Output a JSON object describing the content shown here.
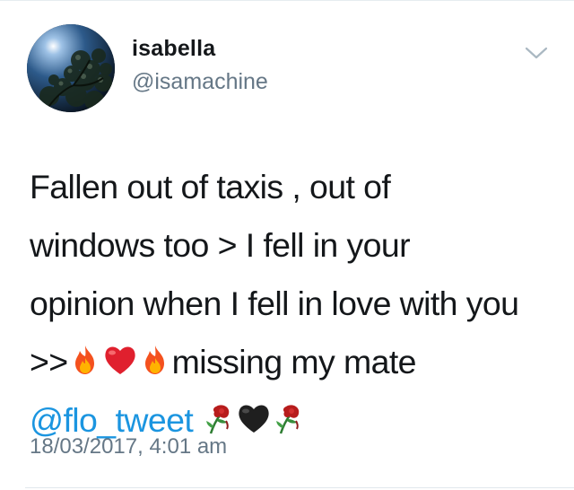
{
  "user": {
    "display_name": "isabella",
    "handle": "@isamachine",
    "avatar_icon": "avatar-sky-tree-icon"
  },
  "menu": {
    "icon": "chevron-down-icon"
  },
  "tweet": {
    "line1": "Fallen out of taxis , out of",
    "line2": "windows too > I fell in your",
    "line3": "opinion when I fell in love with you",
    "line4_prefix": ">>",
    "line4_suffix": "missing my mate",
    "mention": "@flo_tweet",
    "line4_emojis": [
      "fire-emoji",
      "red-heart-emoji",
      "fire-emoji"
    ],
    "line5_emojis": [
      "wilted-flower-emoji",
      "black-heart-emoji",
      "wilted-flower-emoji"
    ]
  },
  "timestamp": "18/03/2017, 4:01 am",
  "colors": {
    "text": "#14171a",
    "secondary": "#657786",
    "link": "#1b95e0",
    "divider": "#e1e8ed"
  }
}
